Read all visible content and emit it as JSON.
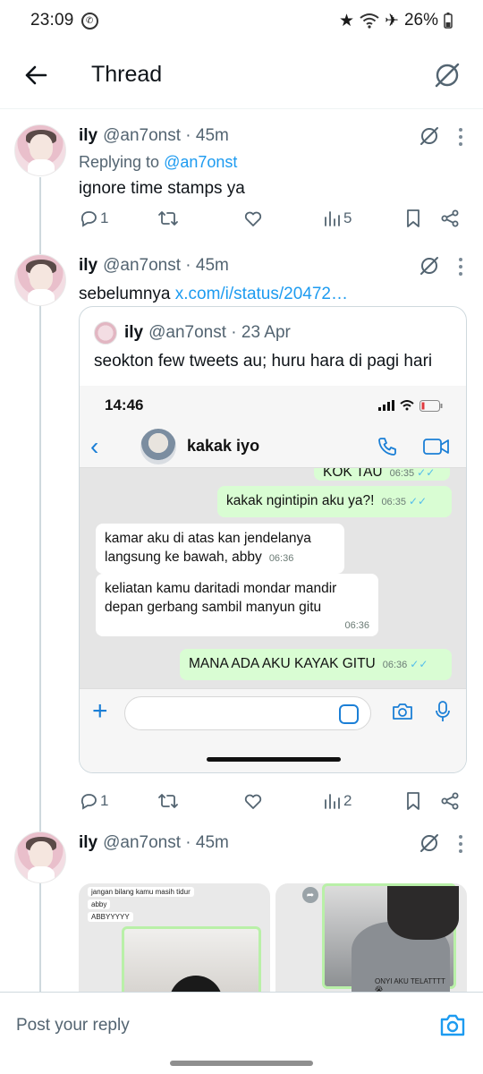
{
  "status_bar": {
    "time": "23:09",
    "battery": "26%"
  },
  "header": {
    "title": "Thread"
  },
  "tweets": [
    {
      "name": "ily",
      "handle": "@an7onst · 45m",
      "replying_prefix": "Replying to ",
      "replying_to": "@an7onst",
      "text": "ignore time stamps ya",
      "replies": "1",
      "retweets": "",
      "likes": "",
      "views": "5"
    },
    {
      "name": "ily",
      "handle": "@an7onst · 45m",
      "text": "sebelumnya ",
      "link": "x.com/i/status/20472…",
      "replies": "1",
      "retweets": "",
      "likes": "",
      "views": "2",
      "quote": {
        "name": "ily",
        "handle": "@an7onst · 23 Apr",
        "text": "seokton few tweets au; huru hara di pagi hari",
        "chat": {
          "time": "14:46",
          "contact": "kakak iyo",
          "messages": [
            {
              "dir": "out",
              "text": "KOK TAU",
              "time": "06:35"
            },
            {
              "dir": "out",
              "text": "kakak ngintipin aku ya?!",
              "time": "06:35"
            },
            {
              "dir": "in",
              "text": "kamar aku di atas kan jendelanya langsung ke bawah, abby",
              "time": "06:36"
            },
            {
              "dir": "in",
              "text": "keliatan kamu daritadi mondar mandir depan gerbang sambil manyun gitu",
              "time": "06:36"
            },
            {
              "dir": "out",
              "text": "MANA ADA AKU KAYAK GITU",
              "time": "06:36"
            }
          ]
        }
      }
    },
    {
      "name": "ily",
      "handle": "@an7onst · 45m",
      "image_texts": {
        "a1": "jangan bilang kamu masih tidur",
        "a2": "abby",
        "a3": "ABBYYYYY",
        "b1": "ONYI AKU TELATTTT 😭"
      }
    }
  ],
  "reply_bar": {
    "placeholder": "Post your reply"
  },
  "colors": {
    "accent": "#1d9bf0",
    "muted": "#536471",
    "whatsapp_out": "#d9fdd3"
  }
}
